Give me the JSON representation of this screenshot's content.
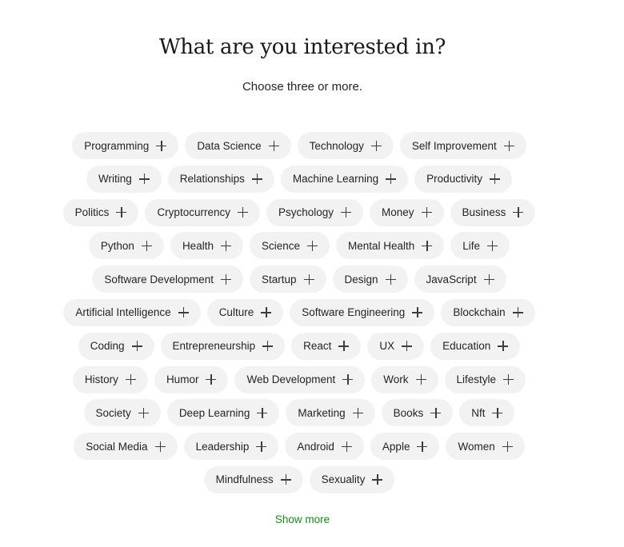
{
  "header": {
    "title": "What are you interested in?",
    "subtitle": "Choose three or more."
  },
  "topic_rows": [
    [
      "Programming",
      "Data Science",
      "Technology",
      "Self Improvement"
    ],
    [
      "Writing",
      "Relationships",
      "Machine Learning",
      "Productivity"
    ],
    [
      "Politics",
      "Cryptocurrency",
      "Psychology",
      "Money",
      "Business"
    ],
    [
      "Python",
      "Health",
      "Science",
      "Mental Health",
      "Life"
    ],
    [
      "Software Development",
      "Startup",
      "Design",
      "JavaScript"
    ],
    [
      "Artificial Intelligence",
      "Culture",
      "Software Engineering",
      "Blockchain"
    ],
    [
      "Coding",
      "Entrepreneurship",
      "React",
      "UX",
      "Education"
    ],
    [
      "History",
      "Humor",
      "Web Development",
      "Work",
      "Lifestyle"
    ],
    [
      "Society",
      "Deep Learning",
      "Marketing",
      "Books",
      "Nft"
    ],
    [
      "Social Media",
      "Leadership",
      "Android",
      "Apple",
      "Women"
    ],
    [
      "Mindfulness",
      "Sexuality"
    ]
  ],
  "topic_icon": "plus-icon",
  "show_more_label": "Show more",
  "colors": {
    "pill_background": "#f2f2f2",
    "text": "#242424",
    "accent_green": "#1a8917"
  }
}
